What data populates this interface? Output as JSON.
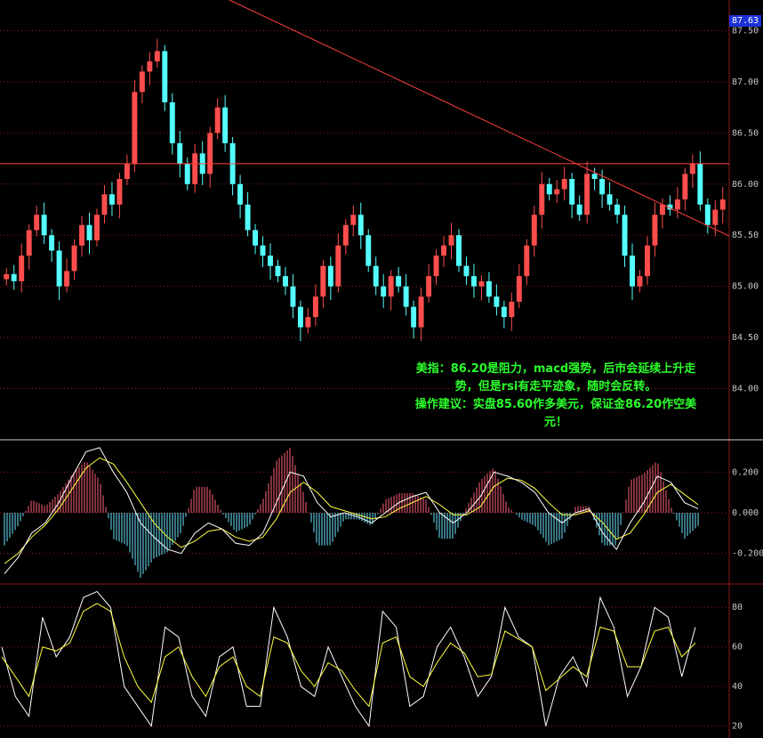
{
  "current_price": "87.63",
  "annotation": {
    "lines": [
      "美指：86.20是阻力，macd强势，后市会延续上升走",
      "势，但是rsi有走平迹象，随时会反转。",
      "操作建议：实盘85.60作多美元，保证金86.20作空美",
      "元！"
    ]
  },
  "colors": {
    "background": "#000000",
    "up_candle": "#ff4d4d",
    "down_candle": "#54ffff",
    "gridline": "#8b1a1a",
    "trendline": "#ff4040",
    "macd_line": "#ffffff",
    "signal_line": "#ffff40",
    "annotation": "#2bff2b",
    "price_badge": "#1b33d6"
  },
  "chart_data": [
    {
      "panel": "price",
      "type": "candlestick",
      "y_ticks": [
        "87.50",
        "87.00",
        "86.50",
        "86.00",
        "85.50",
        "85.00",
        "84.50",
        "84.00"
      ],
      "ylim": [
        83.5,
        87.8
      ],
      "close": [
        85.12,
        85.05,
        85.3,
        85.55,
        85.7,
        85.5,
        85.35,
        85.0,
        85.15,
        85.4,
        85.6,
        85.45,
        85.7,
        85.9,
        85.8,
        86.05,
        86.2,
        86.9,
        87.1,
        87.2,
        87.3,
        86.8,
        86.4,
        86.2,
        86.0,
        86.3,
        86.1,
        86.5,
        86.75,
        86.4,
        86.0,
        85.8,
        85.55,
        85.4,
        85.3,
        85.2,
        85.1,
        85.0,
        84.8,
        84.6,
        84.7,
        84.9,
        85.2,
        85.0,
        85.4,
        85.6,
        85.7,
        85.5,
        85.2,
        85.0,
        84.9,
        85.1,
        85.0,
        84.8,
        84.6,
        84.9,
        85.1,
        85.3,
        85.4,
        85.5,
        85.2,
        85.1,
        85.0,
        85.05,
        84.9,
        84.8,
        84.7,
        84.85,
        85.1,
        85.4,
        85.7,
        86.0,
        85.9,
        85.95,
        86.05,
        85.8,
        85.7,
        86.1,
        86.05,
        85.9,
        85.8,
        85.7,
        85.3,
        85.0,
        85.1,
        85.4,
        85.7,
        85.8,
        85.75,
        85.85,
        86.1,
        86.2,
        85.8,
        85.6,
        85.75,
        85.85
      ],
      "trendline": {
        "from": {
          "bar": 18,
          "price": 87.95
        },
        "to": {
          "bar": 95,
          "price": 85.52
        }
      },
      "resistance_level": 86.2
    },
    {
      "panel": "macd",
      "type": "line+histogram",
      "y_ticks": [
        "0.200",
        "0.000",
        "-0.200"
      ],
      "ylim": [
        -0.35,
        0.35
      ],
      "macd": [
        -0.3,
        -0.22,
        -0.1,
        -0.05,
        0.05,
        0.18,
        0.3,
        0.32,
        0.2,
        0.1,
        -0.05,
        -0.12,
        -0.18,
        -0.2,
        -0.1,
        -0.05,
        -0.08,
        -0.15,
        -0.16,
        -0.1,
        0.05,
        0.2,
        0.18,
        0.05,
        -0.02,
        0.0,
        -0.02,
        -0.05,
        0.0,
        0.05,
        0.08,
        0.1,
        0.0,
        -0.05,
        0.0,
        0.08,
        0.2,
        0.18,
        0.15,
        0.1,
        0.0,
        -0.05,
        0.0,
        0.02,
        -0.1,
        -0.18,
        -0.05,
        0.05,
        0.18,
        0.15,
        0.05,
        0.02
      ],
      "signal": [
        -0.25,
        -0.2,
        -0.12,
        -0.06,
        0.02,
        0.12,
        0.22,
        0.27,
        0.24,
        0.15,
        0.05,
        -0.05,
        -0.12,
        -0.17,
        -0.14,
        -0.09,
        -0.08,
        -0.12,
        -0.14,
        -0.12,
        -0.03,
        0.1,
        0.15,
        0.1,
        0.03,
        0.01,
        -0.01,
        -0.03,
        -0.02,
        0.02,
        0.05,
        0.08,
        0.04,
        -0.01,
        -0.01,
        0.03,
        0.13,
        0.17,
        0.16,
        0.12,
        0.05,
        -0.01,
        -0.01,
        0.01,
        -0.05,
        -0.13,
        -0.1,
        -0.01,
        0.1,
        0.14,
        0.09,
        0.04
      ]
    },
    {
      "panel": "rsi",
      "type": "line",
      "y_ticks": [
        "80",
        "60",
        "40",
        "20"
      ],
      "ylim": [
        14,
        90
      ],
      "rsi_fast": [
        60,
        35,
        25,
        75,
        55,
        65,
        85,
        88,
        80,
        40,
        30,
        20,
        70,
        65,
        35,
        25,
        55,
        60,
        30,
        30,
        80,
        65,
        40,
        35,
        60,
        45,
        30,
        20,
        78,
        70,
        30,
        35,
        60,
        70,
        55,
        35,
        45,
        80,
        65,
        60,
        20,
        45,
        55,
        40,
        85,
        70,
        35,
        50,
        80,
        75,
        45,
        70
      ],
      "rsi_slow": [
        55,
        45,
        35,
        60,
        58,
        62,
        78,
        82,
        78,
        55,
        40,
        32,
        55,
        60,
        45,
        35,
        50,
        55,
        40,
        35,
        65,
        62,
        48,
        40,
        52,
        48,
        38,
        30,
        62,
        65,
        45,
        40,
        52,
        62,
        57,
        45,
        46,
        68,
        64,
        60,
        38,
        44,
        50,
        45,
        70,
        68,
        50,
        50,
        68,
        70,
        55,
        62
      ]
    }
  ]
}
